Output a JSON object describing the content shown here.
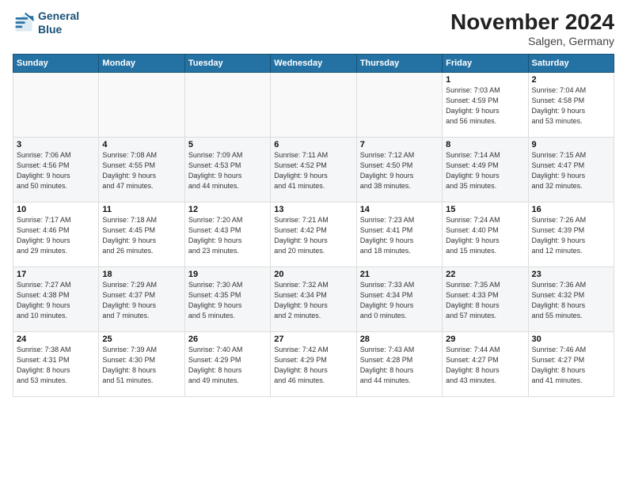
{
  "header": {
    "logo_line1": "General",
    "logo_line2": "Blue",
    "title": "November 2024",
    "location": "Salgen, Germany"
  },
  "days_of_week": [
    "Sunday",
    "Monday",
    "Tuesday",
    "Wednesday",
    "Thursday",
    "Friday",
    "Saturday"
  ],
  "weeks": [
    [
      {
        "day": "",
        "info": ""
      },
      {
        "day": "",
        "info": ""
      },
      {
        "day": "",
        "info": ""
      },
      {
        "day": "",
        "info": ""
      },
      {
        "day": "",
        "info": ""
      },
      {
        "day": "1",
        "info": "Sunrise: 7:03 AM\nSunset: 4:59 PM\nDaylight: 9 hours\nand 56 minutes."
      },
      {
        "day": "2",
        "info": "Sunrise: 7:04 AM\nSunset: 4:58 PM\nDaylight: 9 hours\nand 53 minutes."
      }
    ],
    [
      {
        "day": "3",
        "info": "Sunrise: 7:06 AM\nSunset: 4:56 PM\nDaylight: 9 hours\nand 50 minutes."
      },
      {
        "day": "4",
        "info": "Sunrise: 7:08 AM\nSunset: 4:55 PM\nDaylight: 9 hours\nand 47 minutes."
      },
      {
        "day": "5",
        "info": "Sunrise: 7:09 AM\nSunset: 4:53 PM\nDaylight: 9 hours\nand 44 minutes."
      },
      {
        "day": "6",
        "info": "Sunrise: 7:11 AM\nSunset: 4:52 PM\nDaylight: 9 hours\nand 41 minutes."
      },
      {
        "day": "7",
        "info": "Sunrise: 7:12 AM\nSunset: 4:50 PM\nDaylight: 9 hours\nand 38 minutes."
      },
      {
        "day": "8",
        "info": "Sunrise: 7:14 AM\nSunset: 4:49 PM\nDaylight: 9 hours\nand 35 minutes."
      },
      {
        "day": "9",
        "info": "Sunrise: 7:15 AM\nSunset: 4:47 PM\nDaylight: 9 hours\nand 32 minutes."
      }
    ],
    [
      {
        "day": "10",
        "info": "Sunrise: 7:17 AM\nSunset: 4:46 PM\nDaylight: 9 hours\nand 29 minutes."
      },
      {
        "day": "11",
        "info": "Sunrise: 7:18 AM\nSunset: 4:45 PM\nDaylight: 9 hours\nand 26 minutes."
      },
      {
        "day": "12",
        "info": "Sunrise: 7:20 AM\nSunset: 4:43 PM\nDaylight: 9 hours\nand 23 minutes."
      },
      {
        "day": "13",
        "info": "Sunrise: 7:21 AM\nSunset: 4:42 PM\nDaylight: 9 hours\nand 20 minutes."
      },
      {
        "day": "14",
        "info": "Sunrise: 7:23 AM\nSunset: 4:41 PM\nDaylight: 9 hours\nand 18 minutes."
      },
      {
        "day": "15",
        "info": "Sunrise: 7:24 AM\nSunset: 4:40 PM\nDaylight: 9 hours\nand 15 minutes."
      },
      {
        "day": "16",
        "info": "Sunrise: 7:26 AM\nSunset: 4:39 PM\nDaylight: 9 hours\nand 12 minutes."
      }
    ],
    [
      {
        "day": "17",
        "info": "Sunrise: 7:27 AM\nSunset: 4:38 PM\nDaylight: 9 hours\nand 10 minutes."
      },
      {
        "day": "18",
        "info": "Sunrise: 7:29 AM\nSunset: 4:37 PM\nDaylight: 9 hours\nand 7 minutes."
      },
      {
        "day": "19",
        "info": "Sunrise: 7:30 AM\nSunset: 4:35 PM\nDaylight: 9 hours\nand 5 minutes."
      },
      {
        "day": "20",
        "info": "Sunrise: 7:32 AM\nSunset: 4:34 PM\nDaylight: 9 hours\nand 2 minutes."
      },
      {
        "day": "21",
        "info": "Sunrise: 7:33 AM\nSunset: 4:34 PM\nDaylight: 9 hours\nand 0 minutes."
      },
      {
        "day": "22",
        "info": "Sunrise: 7:35 AM\nSunset: 4:33 PM\nDaylight: 8 hours\nand 57 minutes."
      },
      {
        "day": "23",
        "info": "Sunrise: 7:36 AM\nSunset: 4:32 PM\nDaylight: 8 hours\nand 55 minutes."
      }
    ],
    [
      {
        "day": "24",
        "info": "Sunrise: 7:38 AM\nSunset: 4:31 PM\nDaylight: 8 hours\nand 53 minutes."
      },
      {
        "day": "25",
        "info": "Sunrise: 7:39 AM\nSunset: 4:30 PM\nDaylight: 8 hours\nand 51 minutes."
      },
      {
        "day": "26",
        "info": "Sunrise: 7:40 AM\nSunset: 4:29 PM\nDaylight: 8 hours\nand 49 minutes."
      },
      {
        "day": "27",
        "info": "Sunrise: 7:42 AM\nSunset: 4:29 PM\nDaylight: 8 hours\nand 46 minutes."
      },
      {
        "day": "28",
        "info": "Sunrise: 7:43 AM\nSunset: 4:28 PM\nDaylight: 8 hours\nand 44 minutes."
      },
      {
        "day": "29",
        "info": "Sunrise: 7:44 AM\nSunset: 4:27 PM\nDaylight: 8 hours\nand 43 minutes."
      },
      {
        "day": "30",
        "info": "Sunrise: 7:46 AM\nSunset: 4:27 PM\nDaylight: 8 hours\nand 41 minutes."
      }
    ]
  ]
}
